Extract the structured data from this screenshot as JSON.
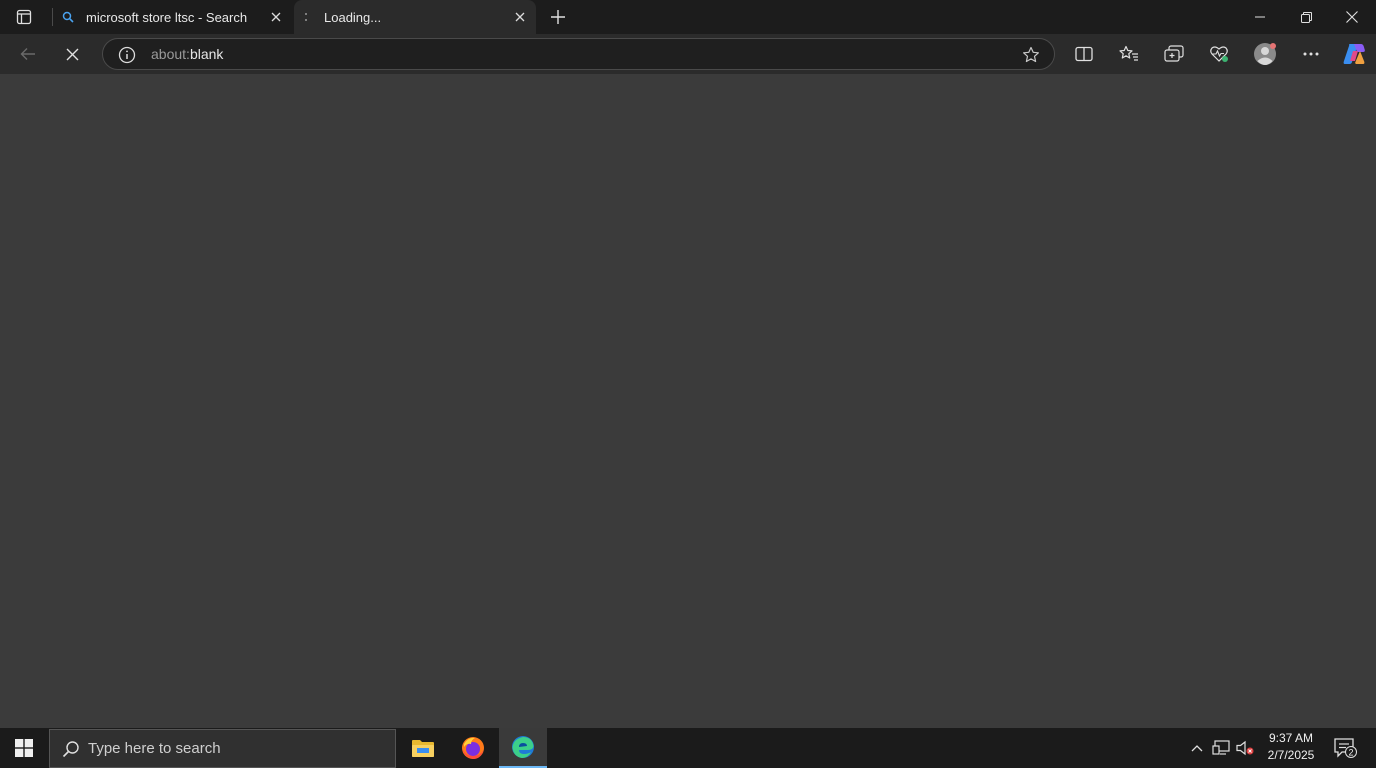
{
  "browser": {
    "tabs": [
      {
        "title": "microsoft store ltsc - Search",
        "favicon": "search-icon",
        "active": false
      },
      {
        "title": "Loading...",
        "favicon": "loading-spinner-icon",
        "active": true
      }
    ],
    "address_bar": {
      "scheme": "about:",
      "path": "blank"
    }
  },
  "taskbar": {
    "search_placeholder": "Type here to search",
    "time": "9:37 AM",
    "date": "2/7/2025",
    "notification_count": "2"
  },
  "colors": {
    "accent": "#6cb8f6",
    "content_bg": "#3b3b3b",
    "titlebar_bg": "#1c1c1c"
  }
}
